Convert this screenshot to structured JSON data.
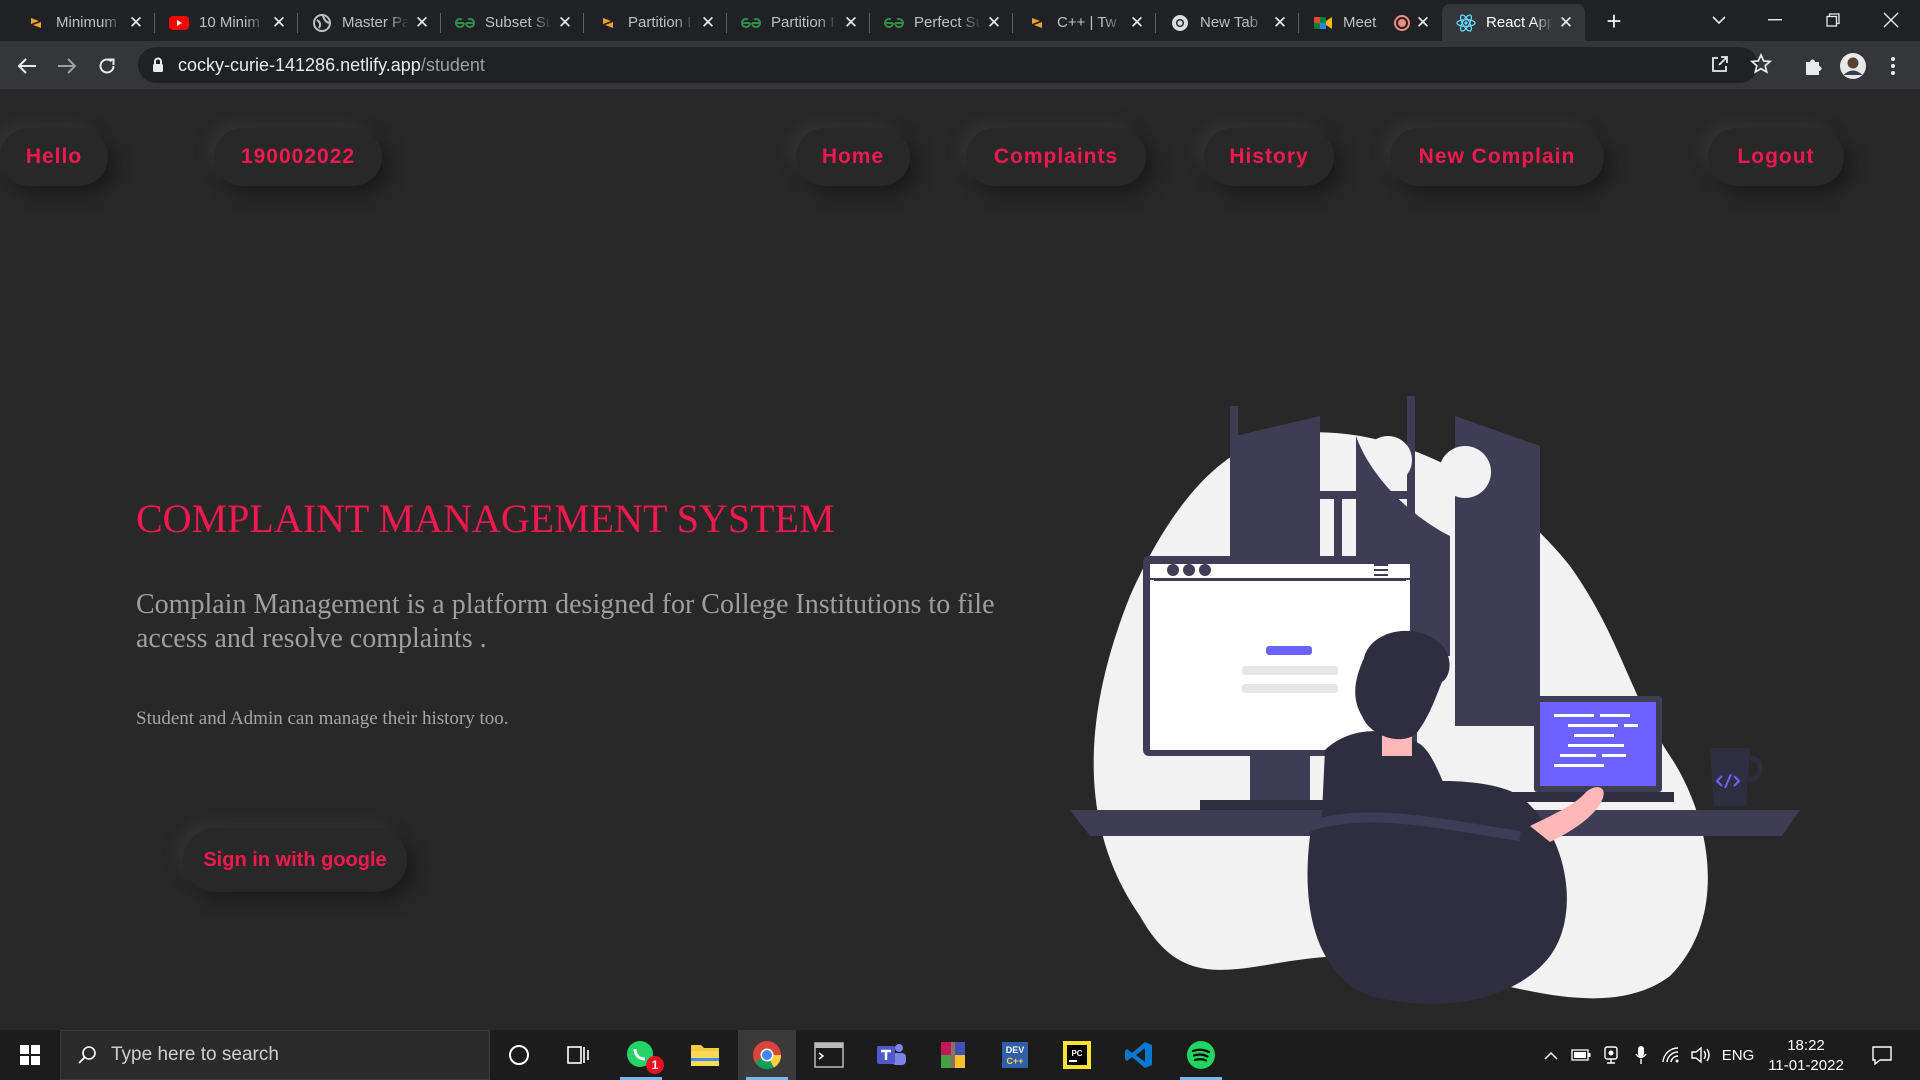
{
  "browser": {
    "tabs": [
      {
        "title": "Minimum",
        "icon": "codingninjas-icon"
      },
      {
        "title": "10 Minim",
        "icon": "youtube-icon"
      },
      {
        "title": "Master Pa",
        "icon": "globe-icon"
      },
      {
        "title": "Subset Su",
        "icon": "geeksforgeeks-icon"
      },
      {
        "title": "Partition I",
        "icon": "codingninjas-icon"
      },
      {
        "title": "Partition I",
        "icon": "geeksforgeeks-icon"
      },
      {
        "title": "Perfect Su",
        "icon": "geeksforgeeks-icon"
      },
      {
        "title": "C++ | Tw",
        "icon": "codingninjas-icon"
      },
      {
        "title": "New Tab",
        "icon": "chrome-icon"
      },
      {
        "title": "Meet",
        "icon": "google-meet-icon"
      },
      {
        "title": "React App",
        "icon": "react-icon"
      }
    ],
    "active_tab": 10,
    "url_host": "cocky-curie-141286.netlify.app",
    "url_path": "/student"
  },
  "nav": {
    "hello": "Hello",
    "user_id": "190002022",
    "home": "Home",
    "complaints": "Complaints",
    "history": "History",
    "new_complain": "New Complain",
    "logout": "Logout"
  },
  "hero": {
    "title": "COMPLAINT MANAGEMENT SYSTEM",
    "description": "Complain Management is a platform designed for College Institutions to file access and resolve complaints .",
    "subtext": "Student and Admin can manage their history too.",
    "signin_label": "Sign in with google"
  },
  "taskbar": {
    "search_placeholder": "Type here to search",
    "whatsapp_badge": "1",
    "language": "ENG",
    "time": "18:22",
    "date": "11-01-2022"
  },
  "colors": {
    "accent": "#f5184f",
    "page_bg": "#282828",
    "illustration_dark": "#3f3d56",
    "illustration_purple": "#6c63ff"
  }
}
